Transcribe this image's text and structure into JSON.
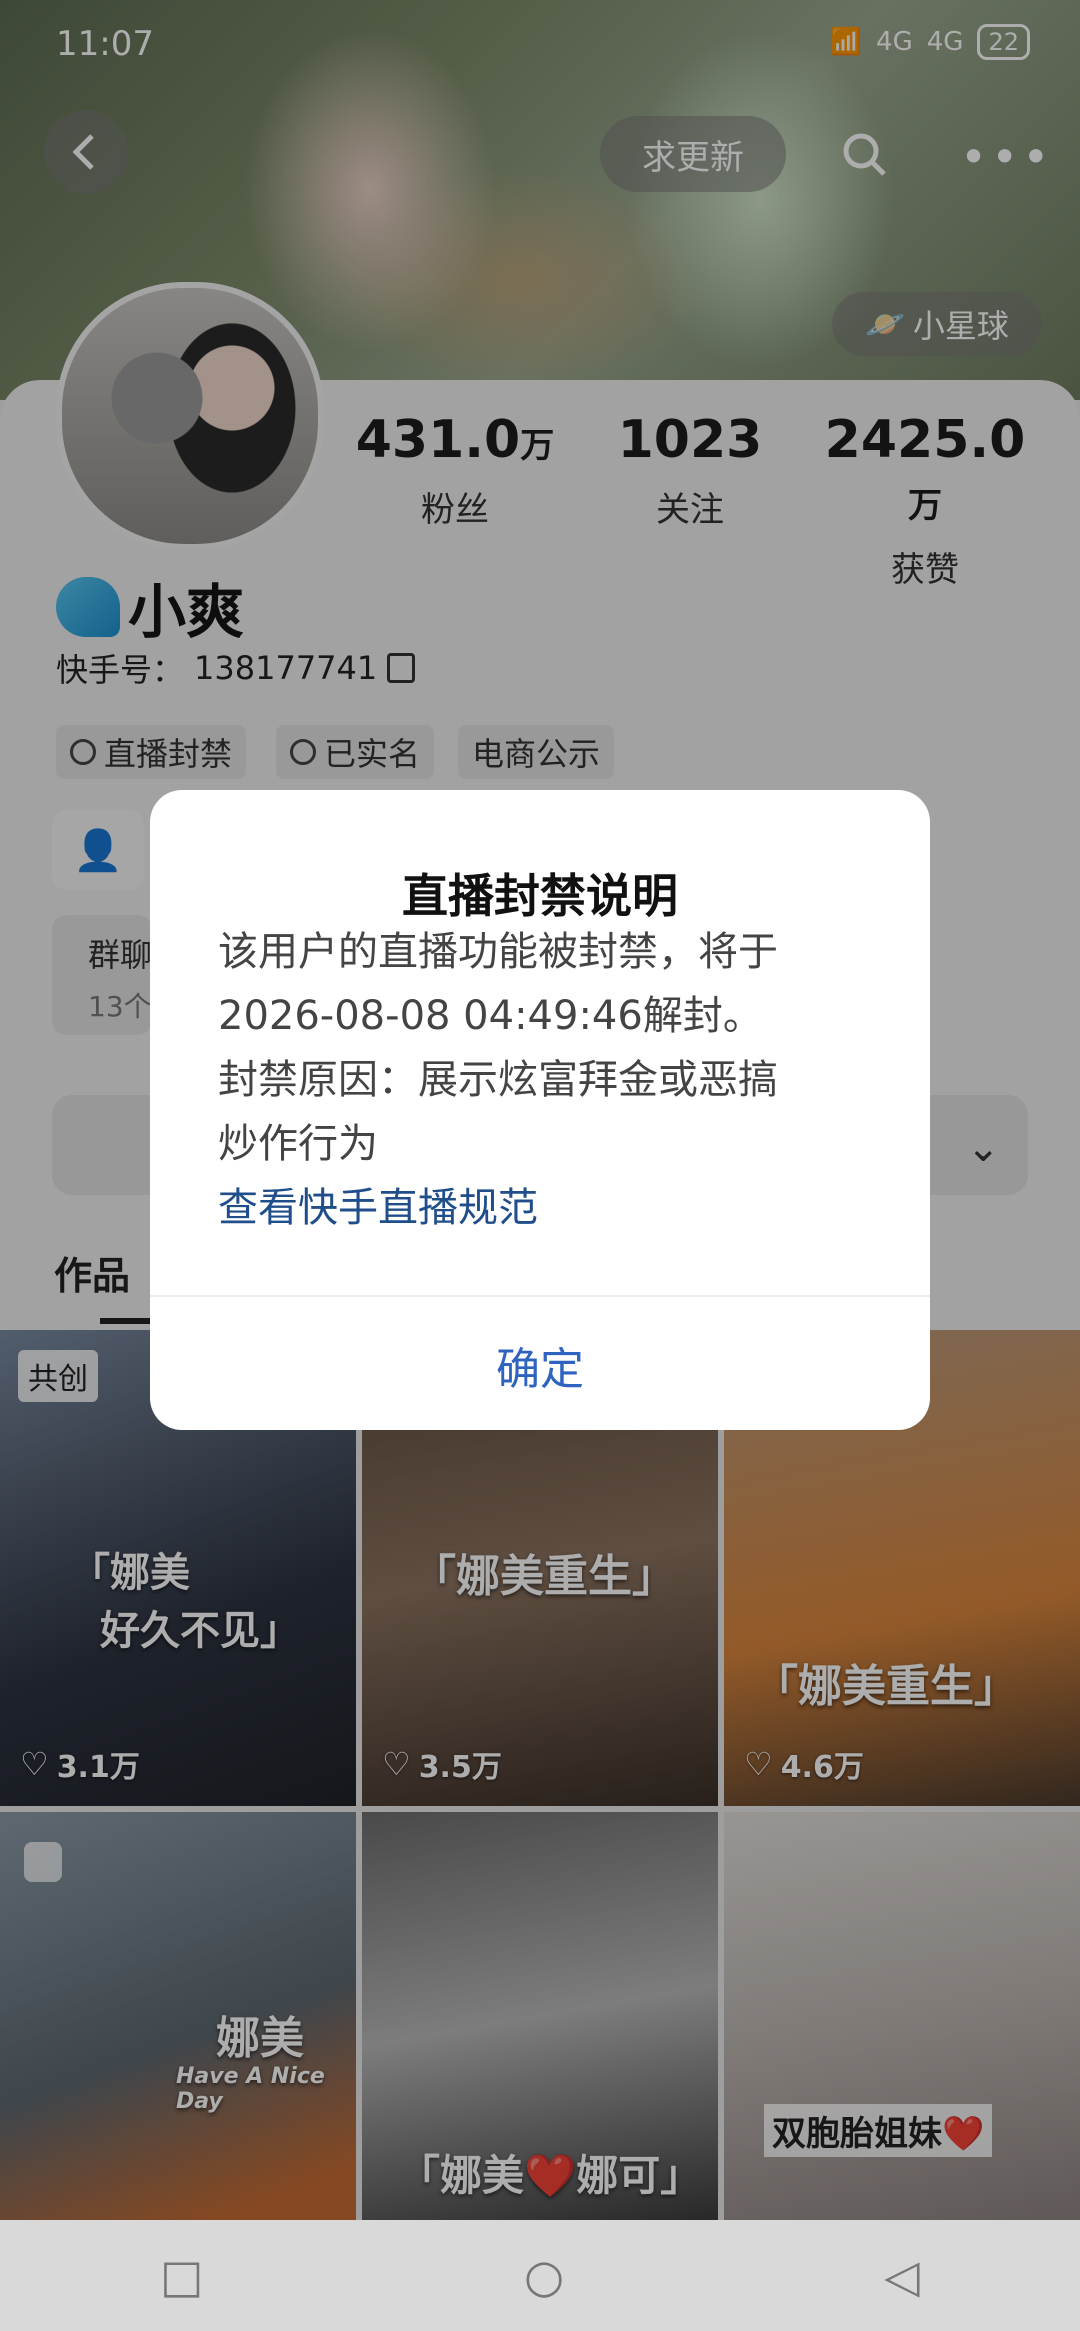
{
  "status_bar": {
    "time": "11:07",
    "network_1": "4G",
    "network_2": "4G",
    "battery": "22"
  },
  "header": {
    "update_button": "求更新",
    "planet_button": "小星球"
  },
  "profile": {
    "stats": [
      {
        "value": "431.0",
        "unit": "万",
        "label": "粉丝"
      },
      {
        "value": "1023",
        "unit": "",
        "label": "关注"
      },
      {
        "value": "2425.0",
        "unit": "万",
        "label": "获赞"
      }
    ],
    "name": "小爽",
    "kuaishou_id_label": "快手号：",
    "kuaishou_id": "138177741",
    "tags": [
      "直播封禁",
      "已实名",
      "电商公示"
    ],
    "group_title": "群聊",
    "group_sub": "13个"
  },
  "tabs": {
    "works": "作品"
  },
  "grid": [
    {
      "badge": "共创",
      "caption1": "「娜美",
      "caption2": "好久不见」",
      "likes": "3.1万"
    },
    {
      "caption1": "「娜美重生」",
      "likes": "3.5万"
    },
    {
      "caption1": "「娜美重生」",
      "likes": "4.6万"
    },
    {
      "caption1": "娜美",
      "caption2": "Have A Nice Day"
    },
    {
      "caption1": "「娜美❤️娜可」"
    },
    {
      "caption1": "双胞胎姐妹❤️"
    }
  ],
  "modal": {
    "title": "直播封禁说明",
    "line1": "该用户的直播功能被封禁，将于",
    "line2": "2026-08-08 04:49:46解封。",
    "line3": "封禁原因：展示炫富拜金或恶搞",
    "line4": "炒作行为",
    "link": "查看快手直播规范",
    "ok": "确定"
  },
  "nav": {
    "recent": "□",
    "home": "○",
    "back": "◁"
  }
}
